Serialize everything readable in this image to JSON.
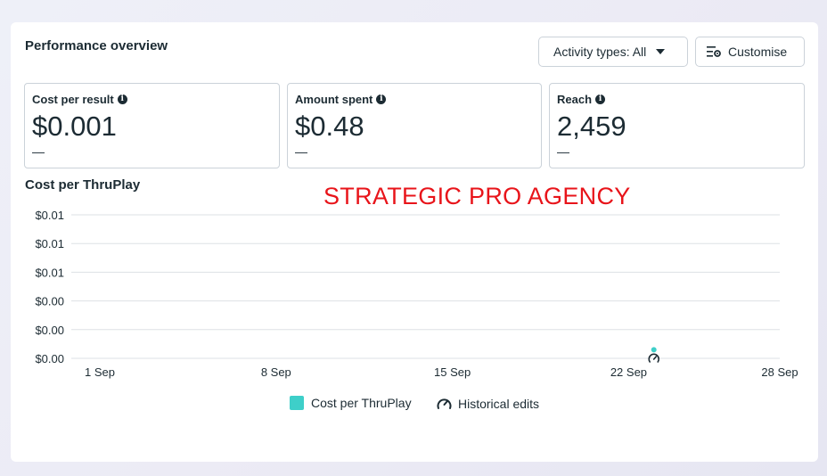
{
  "header": {
    "title": "Performance overview",
    "activity_label": "Activity types: All",
    "customise_label": "Customise"
  },
  "metrics": [
    {
      "label": "Cost per result",
      "value": "$0.001",
      "change": "—"
    },
    {
      "label": "Amount spent",
      "value": "$0.48",
      "change": "—"
    },
    {
      "label": "Reach",
      "value": "2,459",
      "change": "—"
    }
  ],
  "watermark": "STRATEGIC PRO AGENCY",
  "chart_data": {
    "type": "line",
    "title": "Cost per ThruPlay",
    "y_tick_labels": [
      "$0.01",
      "$0.01",
      "$0.01",
      "$0.00",
      "$0.00",
      "$0.00"
    ],
    "x_tick_labels": [
      "1 Sep",
      "8 Sep",
      "15 Sep",
      "22 Sep",
      "28 Sep"
    ],
    "series": [
      {
        "name": "Cost per ThruPlay",
        "color": "#3ecfc9",
        "points": [
          {
            "x": "23 Sep",
            "y": 0.0006
          }
        ]
      }
    ],
    "markers": [
      {
        "name": "Historical edits",
        "x": "23 Sep",
        "icon": "gauge-icon"
      }
    ],
    "grid": true,
    "legend_position": "bottom"
  },
  "legend": {
    "cost_label": "Cost per ThruPlay",
    "cost_color": "#3ecfc9",
    "historical_label": "Historical edits"
  }
}
